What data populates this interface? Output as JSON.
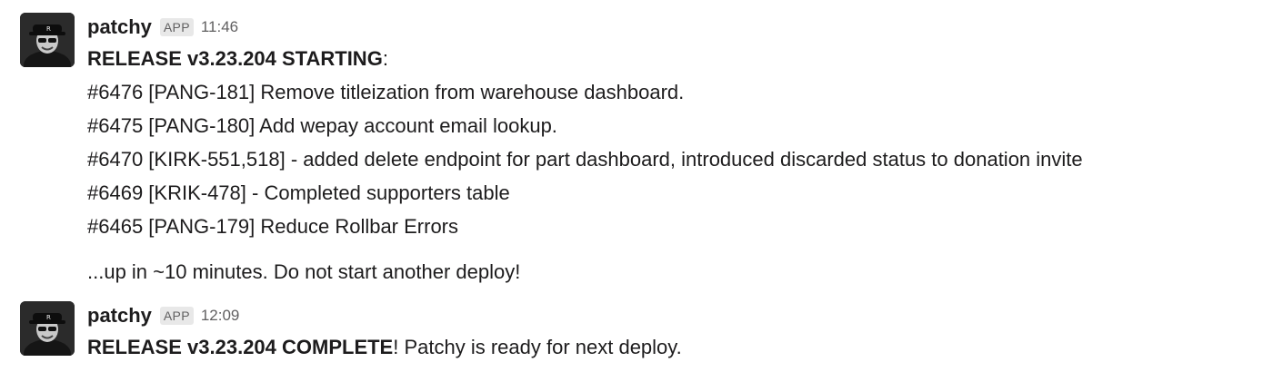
{
  "messages": [
    {
      "sender": "patchy",
      "badge": "APP",
      "time": "11:46",
      "headline": {
        "bold": "RELEASE v3.23.204 STARTING",
        "rest": ":"
      },
      "items": [
        "#6476 [PANG-181] Remove titleization from warehouse dashboard.",
        "#6475 [PANG-180] Add wepay account email lookup.",
        "#6470 [KIRK-551,518] - added delete endpoint for part dashboard, introduced discarded status to donation invite",
        "#6469 [KRIK-478] - Completed supporters table",
        "#6465 [PANG-179] Reduce Rollbar Errors"
      ],
      "footer": "...up in ~10 minutes. Do not start another deploy!"
    },
    {
      "sender": "patchy",
      "badge": "APP",
      "time": "12:09",
      "headline": {
        "bold": "RELEASE v3.23.204 COMPLETE",
        "rest": "! Patchy is ready for next deploy."
      }
    }
  ],
  "icons": {
    "avatar": "patchy-avatar-icon"
  }
}
